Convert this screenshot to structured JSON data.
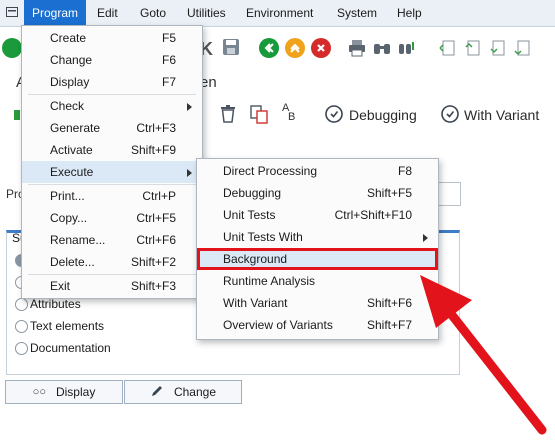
{
  "menubar": {
    "items": [
      "Program",
      "Edit",
      "Goto",
      "Utilities",
      "Environment",
      "System",
      "Help"
    ]
  },
  "toolbar": {
    "visible_text_left": "A",
    "visible_text_right": "en",
    "debugging_label": "Debugging",
    "with_variant_label": "With Variant"
  },
  "form": {
    "object_label": "Pro",
    "subobjects_title": "Su",
    "radios": [
      {
        "label": "Attributes",
        "selected": false
      },
      {
        "label": "Text elements",
        "selected": false
      },
      {
        "label": "Documentation",
        "selected": false
      }
    ],
    "display_button": "Display",
    "change_button": "Change"
  },
  "program_menu": {
    "items": [
      {
        "label": "Create",
        "shortcut": "F5"
      },
      {
        "label": "Change",
        "shortcut": "F6"
      },
      {
        "label": "Display",
        "shortcut": "F7"
      },
      {
        "label": "Check",
        "shortcut": ""
      },
      {
        "label": "Generate",
        "shortcut": "Ctrl+F3"
      },
      {
        "label": "Activate",
        "shortcut": "Shift+F9"
      },
      {
        "label": "Execute",
        "shortcut": ""
      },
      {
        "label": "Print...",
        "shortcut": "Ctrl+P"
      },
      {
        "label": "Copy...",
        "shortcut": "Ctrl+F5"
      },
      {
        "label": "Rename...",
        "shortcut": "Ctrl+F6"
      },
      {
        "label": "Delete...",
        "shortcut": "Shift+F2"
      },
      {
        "label": "Exit",
        "shortcut": "Shift+F3"
      }
    ]
  },
  "execute_menu": {
    "items": [
      {
        "label": "Direct Processing",
        "shortcut": "F8"
      },
      {
        "label": "Debugging",
        "shortcut": "Shift+F5"
      },
      {
        "label": "Unit Tests",
        "shortcut": "Ctrl+Shift+F10"
      },
      {
        "label": "Unit Tests With",
        "shortcut": ""
      },
      {
        "label": "Background",
        "shortcut": ""
      },
      {
        "label": "Runtime Analysis",
        "shortcut": ""
      },
      {
        "label": "With Variant",
        "shortcut": "Shift+F6"
      },
      {
        "label": "Overview of Variants",
        "shortcut": "Shift+F7"
      }
    ]
  },
  "colors": {
    "menu_active": "#1a6fd0",
    "highlight_box": "#e3131b",
    "annotation_arrow": "#e3131b"
  }
}
